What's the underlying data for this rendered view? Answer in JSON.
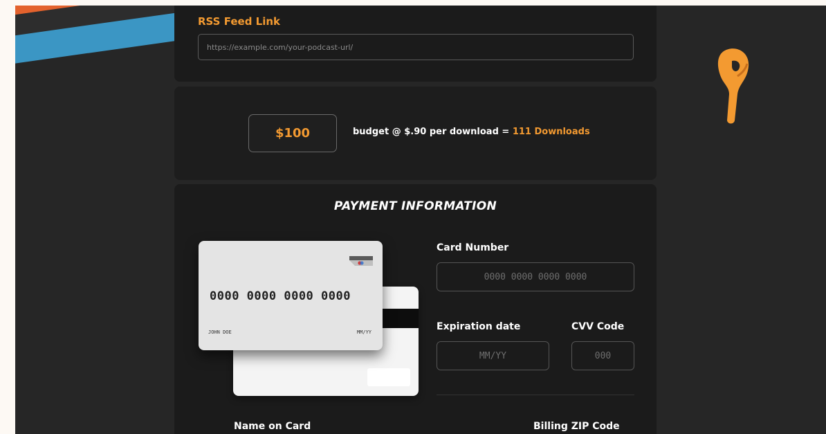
{
  "rss": {
    "label": "RSS Feed Link",
    "placeholder": "https://example.com/your-podcast-url/"
  },
  "budget": {
    "amount": "$100",
    "text_prefix": "budget @ $.90 per download = ",
    "text_highlight": "111 Downloads"
  },
  "payment": {
    "title": "PAYMENT INFORMATION",
    "card_preview": {
      "number": "0000 0000 0000 0000",
      "name": "JOHN DOE",
      "expiry": "MM/YY"
    },
    "card_number_label": "Card Number",
    "card_number_placeholder": "0000 0000 0000 0000",
    "expiration_label": "Expiration date",
    "expiration_placeholder": "MM/YY",
    "cvv_label": "CVV Code",
    "cvv_placeholder": "000",
    "name_label": "Name on Card",
    "zip_label": "Billing ZIP Code"
  },
  "colors": {
    "accent": "#f39a31",
    "background": "#262626",
    "panel": "#1b1b1b"
  },
  "icons": [
    "card-chip-icon",
    "earbud-illustration"
  ]
}
